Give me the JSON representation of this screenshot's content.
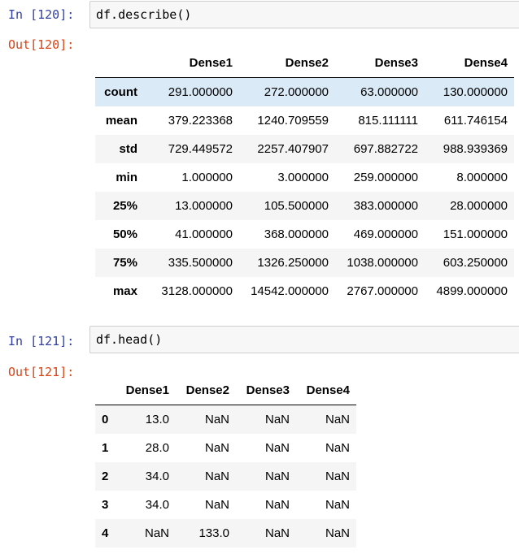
{
  "cells": [
    {
      "in_prompt": "In [120]:",
      "code": "df.describe()",
      "out_prompt": "Out[120]:",
      "columns": [
        "",
        "Dense1",
        "Dense2",
        "Dense3",
        "Dense4"
      ],
      "rows": [
        {
          "index": "count",
          "values": [
            "291.000000",
            "272.000000",
            "63.000000",
            "130.000000"
          ]
        },
        {
          "index": "mean",
          "values": [
            "379.223368",
            "1240.709559",
            "815.111111",
            "611.746154"
          ]
        },
        {
          "index": "std",
          "values": [
            "729.449572",
            "2257.407907",
            "697.882722",
            "988.939369"
          ]
        },
        {
          "index": "min",
          "values": [
            "1.000000",
            "3.000000",
            "259.000000",
            "8.000000"
          ]
        },
        {
          "index": "25%",
          "values": [
            "13.000000",
            "105.500000",
            "383.000000",
            "28.000000"
          ]
        },
        {
          "index": "50%",
          "values": [
            "41.000000",
            "368.000000",
            "469.000000",
            "151.000000"
          ]
        },
        {
          "index": "75%",
          "values": [
            "335.500000",
            "1326.250000",
            "1038.000000",
            "603.250000"
          ]
        },
        {
          "index": "max",
          "values": [
            "3128.000000",
            "14542.000000",
            "2767.000000",
            "4899.000000"
          ]
        }
      ]
    },
    {
      "in_prompt": "In [121]:",
      "code": "df.head()",
      "out_prompt": "Out[121]:",
      "columns": [
        "",
        "Dense1",
        "Dense2",
        "Dense3",
        "Dense4"
      ],
      "rows": [
        {
          "index": "0",
          "values": [
            "13.0",
            "NaN",
            "NaN",
            "NaN"
          ]
        },
        {
          "index": "1",
          "values": [
            "28.0",
            "NaN",
            "NaN",
            "NaN"
          ]
        },
        {
          "index": "2",
          "values": [
            "34.0",
            "NaN",
            "NaN",
            "NaN"
          ]
        },
        {
          "index": "3",
          "values": [
            "34.0",
            "NaN",
            "NaN",
            "NaN"
          ]
        },
        {
          "index": "4",
          "values": [
            "NaN",
            "133.0",
            "NaN",
            "NaN"
          ]
        }
      ]
    }
  ],
  "colors": {
    "in_prompt": "#303f9f",
    "out_prompt": "#d84315",
    "highlight_row": "#dbeaf7",
    "stripe_row": "#f5f5f5"
  }
}
